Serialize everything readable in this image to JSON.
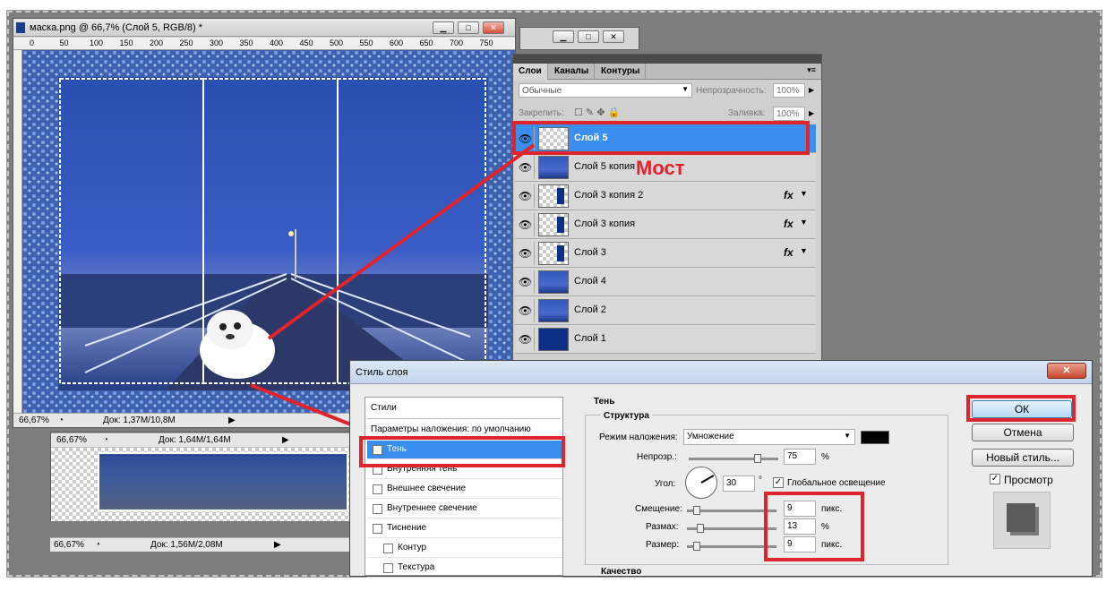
{
  "doc_window": {
    "title": "маска.png @ 66,7% (Слой 5, RGB/8) *",
    "ruler_ticks": [
      "0",
      "50",
      "100",
      "150",
      "200",
      "250",
      "300",
      "350",
      "400",
      "450",
      "500",
      "550",
      "600",
      "650",
      "700",
      "750"
    ],
    "status": {
      "zoom": "66,67%",
      "doc": "Док: 1,37M/10,8M"
    }
  },
  "back_doc_1": {
    "status": {
      "zoom": "66,67%",
      "doc": "Док: 1,64M/1,64M"
    }
  },
  "back_doc_2": {
    "status": {
      "zoom": "66,67%",
      "doc": "Док: 1,56M/2,08M"
    }
  },
  "layers_panel": {
    "tabs": [
      "Слои",
      "Каналы",
      "Контуры"
    ],
    "blend_mode": "Обычные",
    "opacity_label": "Непрозрачность:",
    "opacity_value": "100%",
    "lock_label": "Закрепить:",
    "fill_label": "Заливка:",
    "fill_value": "100%",
    "layers": [
      {
        "name": "Слой 5",
        "selected": true,
        "fx": ""
      },
      {
        "name": "Слой 5 копия",
        "selected": false,
        "fx": ""
      },
      {
        "name": "Слой 3 копия 2",
        "selected": false,
        "fx": "fx"
      },
      {
        "name": "Слой 3 копия",
        "selected": false,
        "fx": "fx"
      },
      {
        "name": "Слой 3",
        "selected": false,
        "fx": "fx"
      },
      {
        "name": "Слой 4",
        "selected": false,
        "fx": ""
      },
      {
        "name": "Слой 2",
        "selected": false,
        "fx": ""
      },
      {
        "name": "Слой 1",
        "selected": false,
        "fx": ""
      }
    ]
  },
  "annotation": {
    "label": "Мост",
    "color": "#e0242c"
  },
  "dialog": {
    "title": "Стиль слоя",
    "styles_header": "Стили",
    "blend_defaults": "Параметры наложения: по умолчанию",
    "styles": [
      {
        "label": "Тень",
        "checked": true,
        "selected": true,
        "indent": false
      },
      {
        "label": "Внутренняя тень",
        "checked": false,
        "selected": false,
        "indent": false
      },
      {
        "label": "Внешнее свечение",
        "checked": false,
        "selected": false,
        "indent": false
      },
      {
        "label": "Внутреннее свечение",
        "checked": false,
        "selected": false,
        "indent": false
      },
      {
        "label": "Тиснение",
        "checked": false,
        "selected": false,
        "indent": false
      },
      {
        "label": "Контур",
        "checked": false,
        "selected": false,
        "indent": true
      },
      {
        "label": "Текстура",
        "checked": false,
        "selected": false,
        "indent": true
      }
    ],
    "section_title": "Тень",
    "group_title": "Структура",
    "blend_mode_label": "Режим наложения:",
    "blend_mode_value": "Умножение",
    "shadow_color": "#000000",
    "opacity_label": "Непрозр.:",
    "opacity_value": "75",
    "percent": "%",
    "angle_label": "Угол:",
    "angle_value": "30",
    "degree": "°",
    "global_light_label": "Глобальное освещение",
    "global_light_checked": true,
    "distance_label": "Смещение:",
    "distance_value": "9",
    "spread_label": "Размах:",
    "spread_value": "13",
    "size_label": "Размер:",
    "size_value": "9",
    "px_unit": "пикс.",
    "quality_title": "Качество",
    "ok_label": "ОК",
    "cancel_label": "Отмена",
    "new_style_label": "Новый стиль...",
    "preview_label": "Просмотр",
    "preview_checked": true
  }
}
